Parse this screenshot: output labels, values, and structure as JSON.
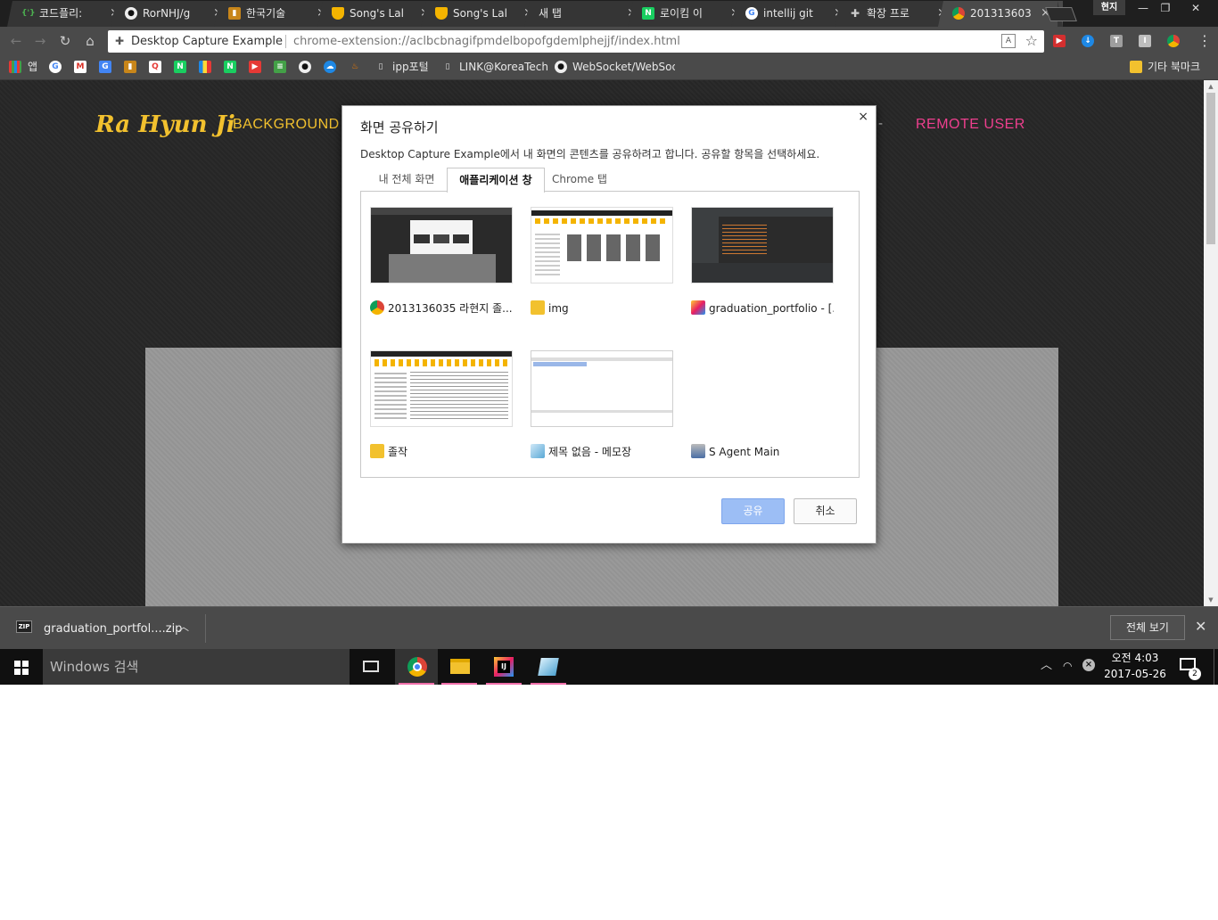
{
  "browser": {
    "tabs": [
      {
        "title": "코드플리:",
        "icon": "brackets-icon",
        "color": "#2e7d32"
      },
      {
        "title": "RorNHJ/g",
        "icon": "github-icon",
        "color": "#333333"
      },
      {
        "title": "한국기술",
        "icon": "koreatech-icon",
        "color": "#c8861a"
      },
      {
        "title": "Song's Lal",
        "icon": "shield-icon",
        "color": "#f4b400"
      },
      {
        "title": "Song's Lal",
        "icon": "shield-icon",
        "color": "#f4b400"
      },
      {
        "title": "새 탭",
        "icon": "",
        "color": ""
      },
      {
        "title": "로이킴 이",
        "icon": "naver-icon",
        "color": "#19ce60"
      },
      {
        "title": "intellij git",
        "icon": "google-icon",
        "color": "#4285f4"
      },
      {
        "title": "확장 프로",
        "icon": "puzzle-icon",
        "color": "#999999"
      },
      {
        "title": "201313603",
        "icon": "chrome-icon",
        "color": "#db4437"
      }
    ],
    "tab_close_glyph": "×",
    "profile_label": "현지",
    "window_controls": {
      "minimize": "—",
      "restore": "❐",
      "close": "✕"
    },
    "omnibox": {
      "extension_name": "Desktop Capture Example",
      "url": "chrome-extension://aclbcbnagifpmdelbopofgdemlphejjf/index.html"
    },
    "bookmarks": {
      "apps_label": "앱",
      "items": [
        "ipp포털",
        "LINK@KoreaTech",
        "WebSocket/WebSock"
      ],
      "other_label": "기타 북마크"
    }
  },
  "page": {
    "logo": "Ra Hyun Ji",
    "nav_background": "BACKGROUND",
    "nav_dash": "-",
    "nav_remote": "REMOTE USER",
    "colors": {
      "accent_yellow": "#f2c12e",
      "accent_pink": "#ee3f8e"
    }
  },
  "dialog": {
    "title": "화면 공유하기",
    "close_glyph": "×",
    "description": "Desktop Capture Example에서 내 화면의 콘텐츠를 공유하려고 합니다. 공유할 항목을 선택하세요.",
    "tabs": [
      "내 전체 화면",
      "애플리케이션 창",
      "Chrome 탭"
    ],
    "active_tab": 1,
    "sources": [
      {
        "label": "2013136035 라현지 졸..."
      },
      {
        "label": "img"
      },
      {
        "label": "graduation_portfolio - [..."
      },
      {
        "label": "졸작"
      },
      {
        "label": "제목 없음 - 메모장"
      },
      {
        "label": "S Agent Main"
      }
    ],
    "share_label": "공유",
    "cancel_label": "취소"
  },
  "download_shelf": {
    "filename": "graduation_portfol....zip",
    "file_badge": "ZIP",
    "show_all_label": "전체 보기"
  },
  "taskbar": {
    "search_placeholder": "Windows 검색",
    "time": "오전 4:03",
    "date": "2017-05-26",
    "notification_count": "2"
  }
}
